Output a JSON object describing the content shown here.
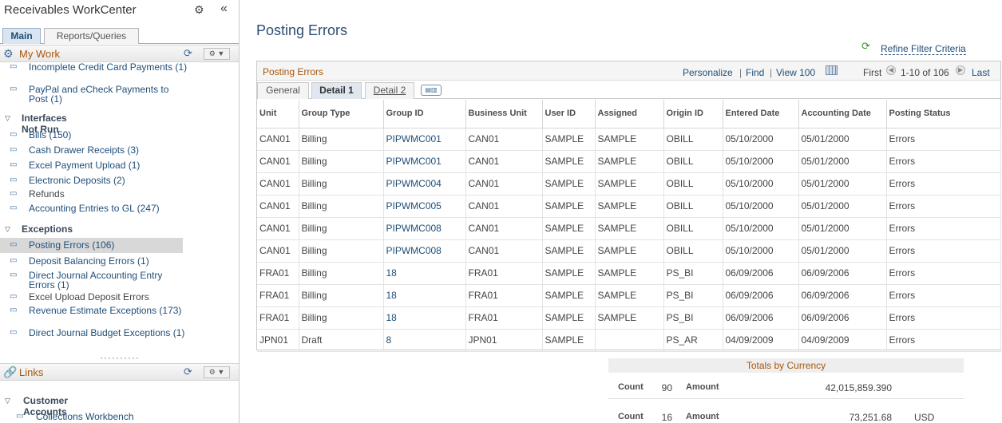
{
  "pane": {
    "title": "Receivables WorkCenter",
    "tabs": {
      "main": "Main",
      "reports": "Reports/Queries"
    },
    "my_work": {
      "title": "My Work",
      "top_items": [
        "Incomplete Credit Card Payments (1)",
        "PayPal and eCheck Payments to Post (1)"
      ],
      "interfaces_label": "Interfaces Not Run",
      "interfaces": [
        "Bills (150)",
        "Cash Drawer Receipts (3)",
        "Excel Payment Upload (1)",
        "Electronic Deposits (2)",
        "Refunds",
        "Accounting Entries to GL (247)"
      ],
      "exceptions_label": "Exceptions",
      "exceptions": [
        "Posting Errors (106)",
        "Deposit Balancing Errors (1)",
        "Direct Journal Accounting Entry Errors (1)",
        "Excel Upload Deposit Errors",
        "Revenue Estimate Exceptions (173)",
        "Direct Journal Budget Exceptions (1)"
      ]
    },
    "links": {
      "title": "Links",
      "group_label": "Customer Accounts",
      "items": [
        "Collections Workbench"
      ]
    }
  },
  "page": {
    "title": "Posting Errors",
    "refine_label": "Refine Filter Criteria"
  },
  "grid": {
    "title": "Posting Errors",
    "personalize": "Personalize",
    "find": "Find",
    "view": "View 100",
    "first": "First",
    "range": "1-10 of 106",
    "last": "Last",
    "tabs": {
      "general": "General",
      "detail1": "Detail 1",
      "detail2": "Detail 2"
    },
    "columns": [
      "Unit",
      "Group Type",
      "Group ID",
      "Business Unit",
      "User ID",
      "Assigned",
      "Origin ID",
      "Entered Date",
      "Accounting Date",
      "Posting Status"
    ],
    "rows": [
      [
        "CAN01",
        "Billing",
        "PIPWMC001",
        "CAN01",
        "SAMPLE",
        "SAMPLE",
        "OBILL",
        "05/10/2000",
        "05/01/2000",
        "Errors"
      ],
      [
        "CAN01",
        "Billing",
        "PIPWMC001",
        "CAN01",
        "SAMPLE",
        "SAMPLE",
        "OBILL",
        "05/10/2000",
        "05/01/2000",
        "Errors"
      ],
      [
        "CAN01",
        "Billing",
        "PIPWMC004",
        "CAN01",
        "SAMPLE",
        "SAMPLE",
        "OBILL",
        "05/10/2000",
        "05/01/2000",
        "Errors"
      ],
      [
        "CAN01",
        "Billing",
        "PIPWMC005",
        "CAN01",
        "SAMPLE",
        "SAMPLE",
        "OBILL",
        "05/10/2000",
        "05/01/2000",
        "Errors"
      ],
      [
        "CAN01",
        "Billing",
        "PIPWMC008",
        "CAN01",
        "SAMPLE",
        "SAMPLE",
        "OBILL",
        "05/10/2000",
        "05/01/2000",
        "Errors"
      ],
      [
        "CAN01",
        "Billing",
        "PIPWMC008",
        "CAN01",
        "SAMPLE",
        "SAMPLE",
        "OBILL",
        "05/10/2000",
        "05/01/2000",
        "Errors"
      ],
      [
        "FRA01",
        "Billing",
        "18",
        "FRA01",
        "SAMPLE",
        "SAMPLE",
        "PS_BI",
        "06/09/2006",
        "06/09/2006",
        "Errors"
      ],
      [
        "FRA01",
        "Billing",
        "18",
        "FRA01",
        "SAMPLE",
        "SAMPLE",
        "PS_BI",
        "06/09/2006",
        "06/09/2006",
        "Errors"
      ],
      [
        "FRA01",
        "Billing",
        "18",
        "FRA01",
        "SAMPLE",
        "SAMPLE",
        "PS_BI",
        "06/09/2006",
        "06/09/2006",
        "Errors"
      ],
      [
        "JPN01",
        "Draft",
        "8",
        "JPN01",
        "SAMPLE",
        "",
        "PS_AR",
        "04/09/2009",
        "04/09/2009",
        "Errors"
      ]
    ]
  },
  "totals": {
    "title": "Totals by Currency",
    "count_label": "Count",
    "amount_label": "Amount",
    "rows": [
      {
        "count": "90",
        "amount": "42,015,859.390",
        "currency": ""
      },
      {
        "count": "16",
        "amount": "73,251.68",
        "currency": "USD"
      }
    ]
  },
  "colors": {
    "accent": "#a8570c",
    "link": "#1f4e79",
    "title": "#2d4e72"
  }
}
